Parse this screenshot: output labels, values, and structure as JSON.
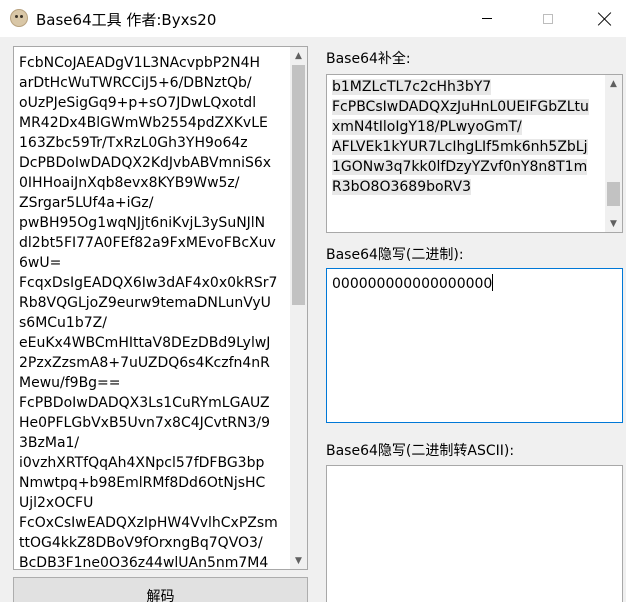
{
  "window": {
    "title": "Base64工具    作者:Byxs20",
    "icon": "app-icon",
    "controls": [
      "minimize-icon",
      "maximize-icon",
      "close-icon"
    ]
  },
  "input_text": "FcbNCoJAEADgV1L3NAcvpbP2N4H\narDtHcWuTWRCCiJ5+6/DBNztQb/\noUzPJeSigGq9+p+sO7JDwLQxotdl\nMR42Dx4BlGWmWb2554pdZXKvLE\n163Zbc59Tr/TxRzL0Gh3YH9o64z\nDcPBDoIwDADQX2KdJvbABVmniS6x\n0IHHoaiJnXqb8evx8KYB9Ww5z/\nZSrgar5LUf4a+iGz/\npwBH95Og1wqNJjt6niKvjL3ySuNJlN\ndl2bt5FI77A0FEf82a9FxMEvoFBcXuv\n6wU=\nFcqxDsIgEADQX6Iw3dAF4x0x0kRSr7\nRb8VQGLjoZ9eurw9temaDNLunVyU\ns6MCu1b7Z/\neEuKx4WBCmHIttaV8DEzDBd9LylwJ\n2PzxZzsmA8+7uUZDQ6s4Kczfn4nR\nMewu/f9Bg==\nFcPBDoIwDADQX3Ls1CuRYmLGAUZ\nHe0PFLGbVxB5Uvn7x8C4JCvtRN3/9\n3BzMa1/\ni0vzhXRTfQqAh4XNpcl57fDFBG3bp\nNmwtpq+b98EmlRMf8Dd6OtNjsHC\nUjl2xOCFU\nFcOxCsIwEADQXzIpHW4VvlhCxPZsm\nttOG4kkZ8DBoV9fOrxngBq7QVO3/\nBcDB3F1ne0O36z44wlUAn5nm7M4",
  "decode_button_label": "解码",
  "padding_label": "Base64补全:",
  "padding_text_lines": [
    "b1MZLcTL7c2cHh3bY7",
    "FcPBCsIwDADQXzJuHnL0UEIFGbZLtu",
    "xmN4tIloIgY18/PLwyoGmT/",
    "AFLVEk1kYUR7LcIhgLIf5mk6nh5ZbLj",
    "1GONw3q7kk0lfDzyYZvf0nY8n8T1m",
    "R3bO8O3689boRV3"
  ],
  "stego_binary_label": "Base64隐写(二进制):",
  "stego_binary_value": "000000000000000000",
  "stego_ascii_label": "Base64隐写(二进制转ASCII):",
  "stego_ascii_value": "",
  "colors": {
    "window_bg": "#f0f0f0",
    "focus_border": "#0078d7",
    "selection": "#e8e8e8",
    "scroll_thumb": "#c2c2c2"
  }
}
